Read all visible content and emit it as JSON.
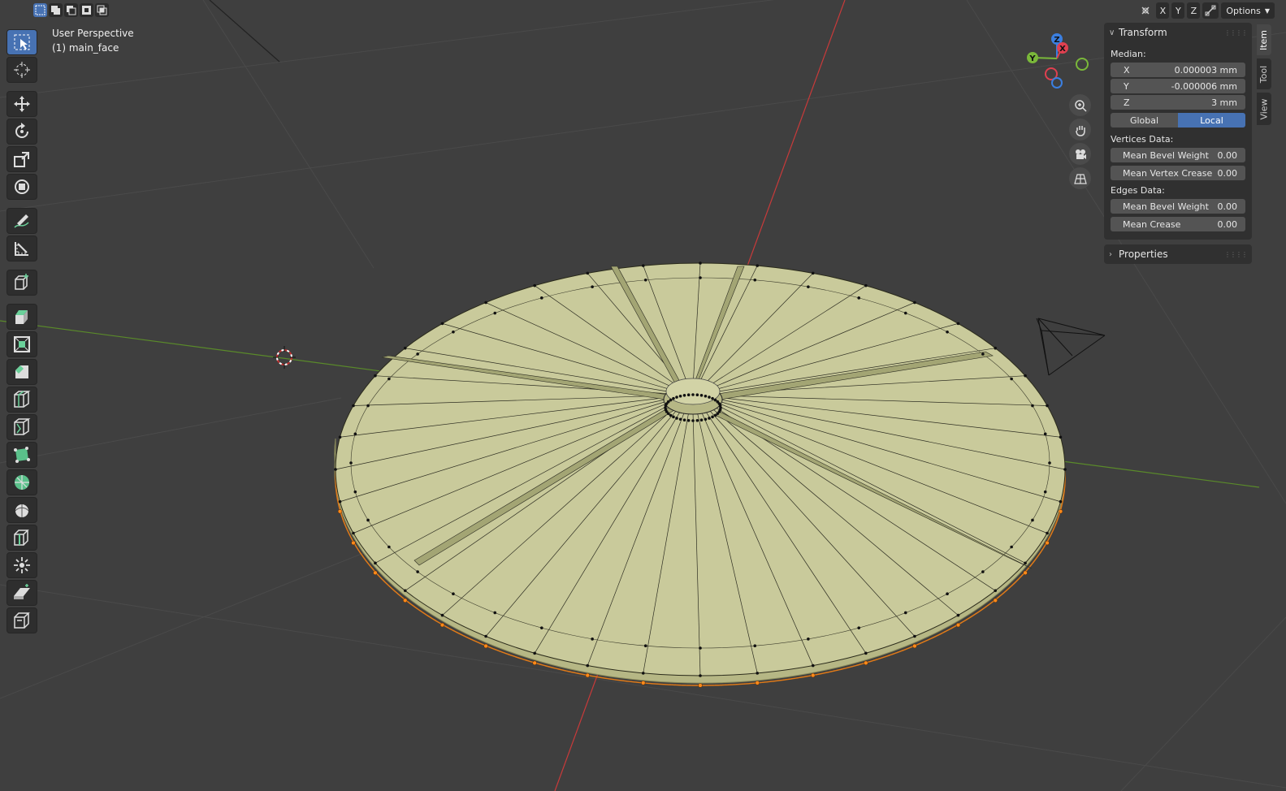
{
  "viewport": {
    "view_name": "User Perspective",
    "object_name": "(1) main_face"
  },
  "header": {
    "axis_buttons": [
      "X",
      "Y",
      "Z"
    ],
    "options_label": "Options"
  },
  "gizmo": {
    "x": "X",
    "y": "Y",
    "z": "Z"
  },
  "toolbar": {
    "tools": [
      "select-box",
      "cursor",
      "move",
      "rotate",
      "scale",
      "transform",
      "annotate",
      "measure",
      "add-cube",
      "extrude-region",
      "inset-faces",
      "bevel",
      "loop-cut",
      "knife",
      "poly-build",
      "spin",
      "smooth",
      "edge-slide",
      "shrink-fatten",
      "shear",
      "rip-region"
    ]
  },
  "npanel": {
    "transform": {
      "title": "Transform",
      "median_label": "Median:",
      "x": {
        "label": "X",
        "value": "0.000003 mm"
      },
      "y": {
        "label": "Y",
        "value": "-0.000006 mm"
      },
      "z": {
        "label": "Z",
        "value": "3 mm"
      },
      "global_label": "Global",
      "local_label": "Local",
      "vertices_label": "Vertices Data:",
      "v_bevel": {
        "label": "Mean Bevel Weight",
        "value": "0.00"
      },
      "v_crease": {
        "label": "Mean Vertex Crease",
        "value": "0.00"
      },
      "edges_label": "Edges Data:",
      "e_bevel": {
        "label": "Mean Bevel Weight",
        "value": "0.00"
      },
      "e_crease": {
        "label": "Mean Crease",
        "value": "0.00"
      }
    },
    "properties": {
      "title": "Properties"
    },
    "tabs": [
      "Item",
      "Tool",
      "View"
    ]
  },
  "colors": {
    "accent": "#4772b3",
    "face": "#c8c99a",
    "face_dark": "#a3a574",
    "x_axis": "#c83a3a",
    "y_axis": "#5a8a2a",
    "selected_vertex": "#ff8a1a"
  }
}
